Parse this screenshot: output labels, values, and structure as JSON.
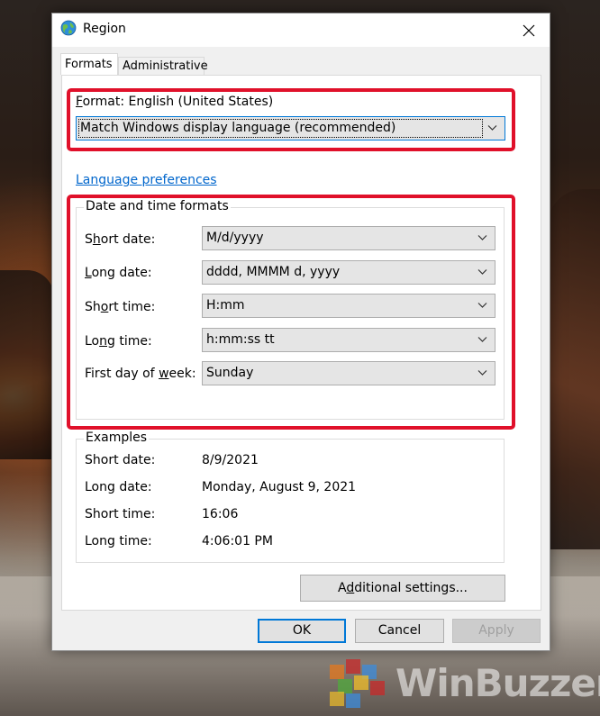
{
  "window": {
    "title": "Region",
    "close_glyph": "✕"
  },
  "tabs": [
    {
      "label": "Formats",
      "active": true
    },
    {
      "label": "Administrative",
      "active": false
    }
  ],
  "format": {
    "label_prefix": "F",
    "label_rest": "ormat: English (United States)",
    "value": "Match Windows display language (recommended)"
  },
  "language_link": "Language preferences",
  "date_time": {
    "title": "Date and time formats",
    "rows": [
      {
        "label_a": "S",
        "label_u": "h",
        "label_b": "ort date:",
        "value": "M/d/yyyy"
      },
      {
        "label_a": "",
        "label_u": "L",
        "label_b": "ong date:",
        "value": "dddd, MMMM d, yyyy"
      },
      {
        "label_a": "Sh",
        "label_u": "o",
        "label_b": "rt time:",
        "value": "H:mm"
      },
      {
        "label_a": "Lo",
        "label_u": "n",
        "label_b": "g time:",
        "value": "h:mm:ss tt"
      },
      {
        "label_a": "First day of ",
        "label_u": "w",
        "label_b": "eek:",
        "value": "Sunday"
      }
    ]
  },
  "examples": {
    "title": "Examples",
    "rows": [
      {
        "label": "Short date:",
        "value": "8/9/2021"
      },
      {
        "label": "Long date:",
        "value": "Monday, August 9, 2021"
      },
      {
        "label": "Short time:",
        "value": "16:06"
      },
      {
        "label": "Long time:",
        "value": "4:06:01 PM"
      }
    ]
  },
  "additional_settings": {
    "prefix": "A",
    "underline": "d",
    "rest": "ditional settings..."
  },
  "buttons": {
    "ok": "OK",
    "cancel": "Cancel",
    "apply": "Apply"
  },
  "watermark": {
    "text": "WinBuzzer"
  },
  "colors": {
    "highlight": "#e0102a",
    "link": "#0066cc",
    "focus": "#0078d7"
  }
}
